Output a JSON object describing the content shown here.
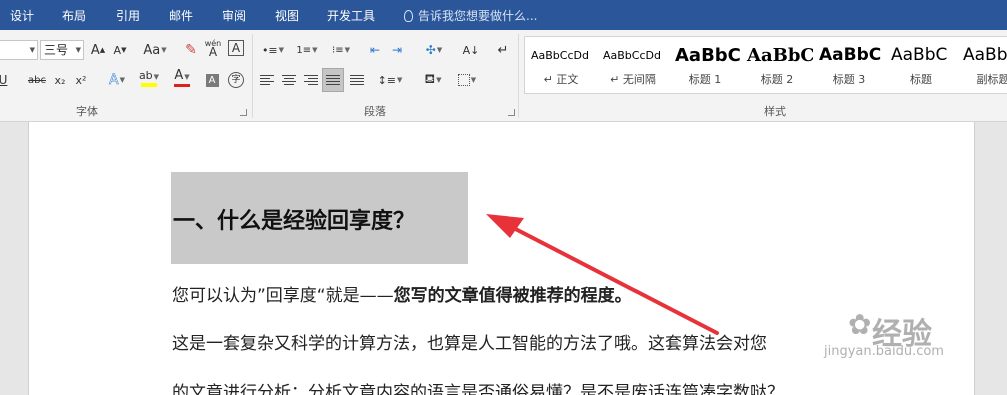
{
  "tabs": [
    "设计",
    "布局",
    "引用",
    "邮件",
    "审阅",
    "视图",
    "开发工具"
  ],
  "tell_me": "告诉我您想要做什么...",
  "font": {
    "size_value": "三号",
    "grow_label": "A",
    "shrink_label": "A",
    "case_label": "Aa",
    "phonetic_label": "wén",
    "phonetic_char": "A",
    "border_label": "A",
    "underline_label": "U",
    "strike_label": "abc",
    "sub_label": "x₂",
    "sup_label": "x²",
    "effects_label": "A",
    "highlight_label": "ab",
    "color_label": "A",
    "shade_label": "A",
    "enclose_label": "字",
    "group_label": "字体"
  },
  "paragraph": {
    "group_label": "段落",
    "sort_label": "A↓",
    "marks_label": "↵"
  },
  "styles": {
    "group_label": "样式",
    "items": [
      {
        "sample": "AaBbCcDd",
        "name": "↵ 正文"
      },
      {
        "sample": "AaBbCcDd",
        "name": "↵ 无间隔"
      },
      {
        "sample": "AaBbC",
        "name": "标题 1"
      },
      {
        "sample": "AaBbC",
        "name": "标题 2"
      },
      {
        "sample": "AaBbC",
        "name": "标题 3"
      },
      {
        "sample": "AaBbC",
        "name": "标题"
      },
      {
        "sample": "AaBbC",
        "name": "副标题"
      }
    ]
  },
  "document": {
    "heading": "一、什么是经验回享度？",
    "para1_normal": "您可以认为”回享度“就是——",
    "para1_bold": "您写的文章值得被推荐的程度。",
    "para2": "这是一套复杂又科学的计算方法，也算是人工智能的方法了哦。这套算法会对您",
    "para3": "的文章进行分析：分析文章内容的语言是否通俗易懂？是不是废话连篇凑字数哒？"
  },
  "watermark": {
    "brand": "经验",
    "url": "jingyan.baidu.com"
  },
  "colors": {
    "ribbon_tab_bg": "#2b579a",
    "highlight_yellow": "#ffff00",
    "font_color_red": "#e0201f",
    "annotation_arrow": "#e8323a",
    "heading_highlight": "#c9c9c9"
  }
}
